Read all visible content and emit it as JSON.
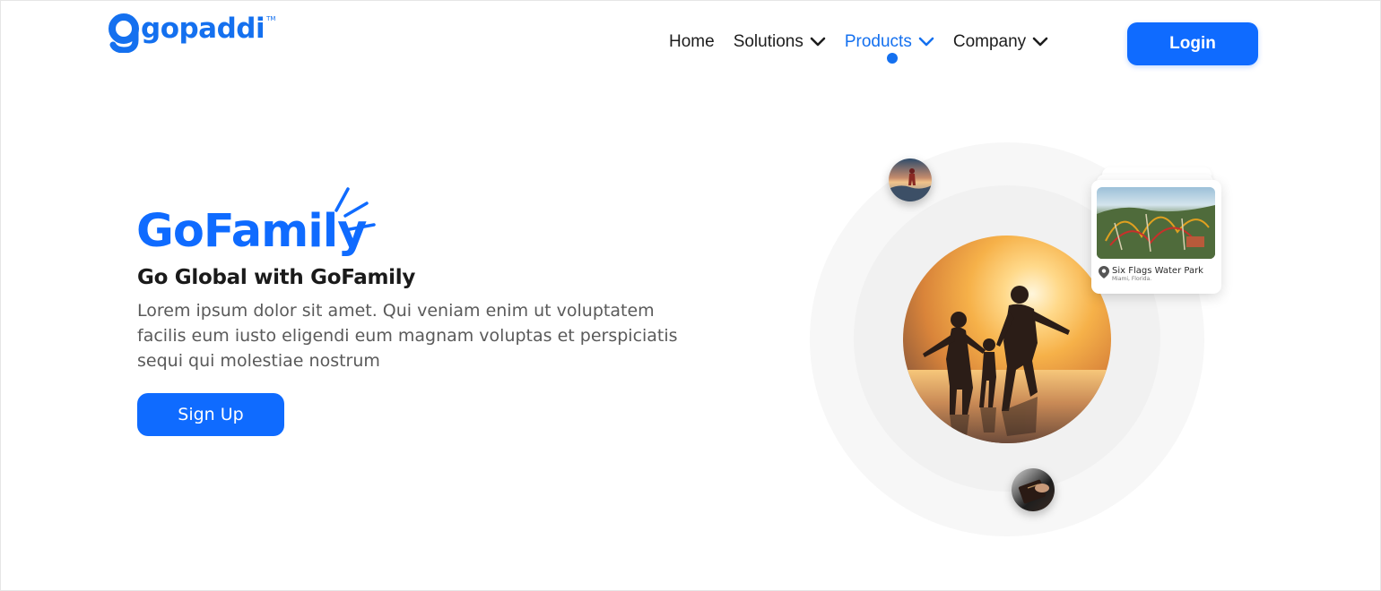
{
  "header": {
    "logo_text": "gopaddi",
    "logo_tm": "TM",
    "nav": [
      {
        "label": "Home",
        "has_dropdown": false,
        "active": false
      },
      {
        "label": "Solutions",
        "has_dropdown": true,
        "active": false
      },
      {
        "label": "Products",
        "has_dropdown": true,
        "active": true
      },
      {
        "label": "Company",
        "has_dropdown": true,
        "active": false
      }
    ],
    "login_label": "Login"
  },
  "hero": {
    "title": "GoFamily",
    "subtitle": "Go Global with GoFamily",
    "description": "Lorem ipsum dolor sit amet. Qui veniam enim ut voluptatem facilis eum iusto eligendi eum magnam voluptas et perspiciatis sequi qui molestiae nostrum",
    "signup_label": "Sign Up"
  },
  "illustration": {
    "place_card": {
      "name": "Six Flags Water Park",
      "location": "Miami, Florida."
    }
  },
  "colors": {
    "brand": "#0f6bff",
    "logo": "#1470ef",
    "text_dark": "#1a1a1a",
    "text_muted": "#5a5a5a"
  }
}
